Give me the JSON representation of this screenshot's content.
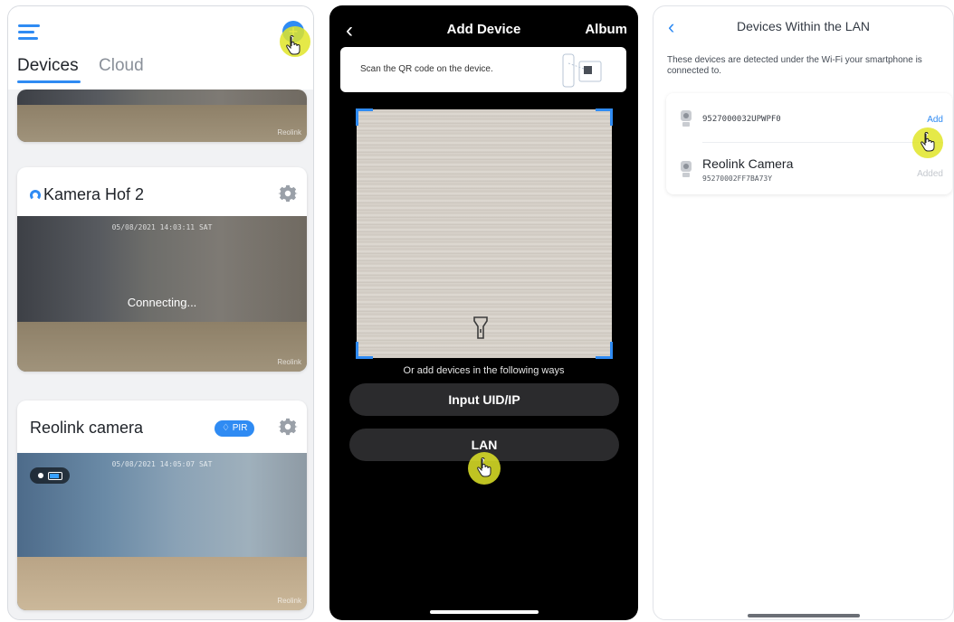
{
  "panel1": {
    "tabs": [
      "Devices",
      "Cloud"
    ],
    "cards": [
      {
        "watermark": "Reolink"
      },
      {
        "title": "Kamera Hof 2",
        "status": "Connecting...",
        "timestamp": "05/08/2021 14:03:11 SAT",
        "watermark": "Reolink"
      },
      {
        "title": "Reolink camera",
        "badge": "PIR",
        "timestamp": "05/08/2021 14:05:07 SAT",
        "watermark": "Reolink"
      }
    ]
  },
  "panel2": {
    "title": "Add Device",
    "album": "Album",
    "scan_hint": "Scan the QR code on the device.",
    "alt_ways": "Or add devices in the following ways",
    "buttons": [
      "Input UID/IP",
      "LAN"
    ]
  },
  "panel3": {
    "title": "Devices Within the LAN",
    "description": "These devices are detected under the Wi-Fi your smartphone is connected to.",
    "devices": [
      {
        "uid": "9527000032UPWPF0",
        "action": "Add"
      },
      {
        "name": "Reolink Camera",
        "uid": "95270002FF7BA73Y",
        "action": "Added"
      }
    ]
  },
  "colors": {
    "accent": "#2f8bf3",
    "tap_indicator": "#e1e528",
    "dark_bg": "#000000",
    "dark_button": "#2b2b2d"
  },
  "icons": [
    "menu-icon",
    "add-icon",
    "gear-icon",
    "back-icon",
    "flashlight-icon",
    "camera-icon",
    "hand-pointer-icon",
    "battery-icon",
    "bell-icon"
  ]
}
